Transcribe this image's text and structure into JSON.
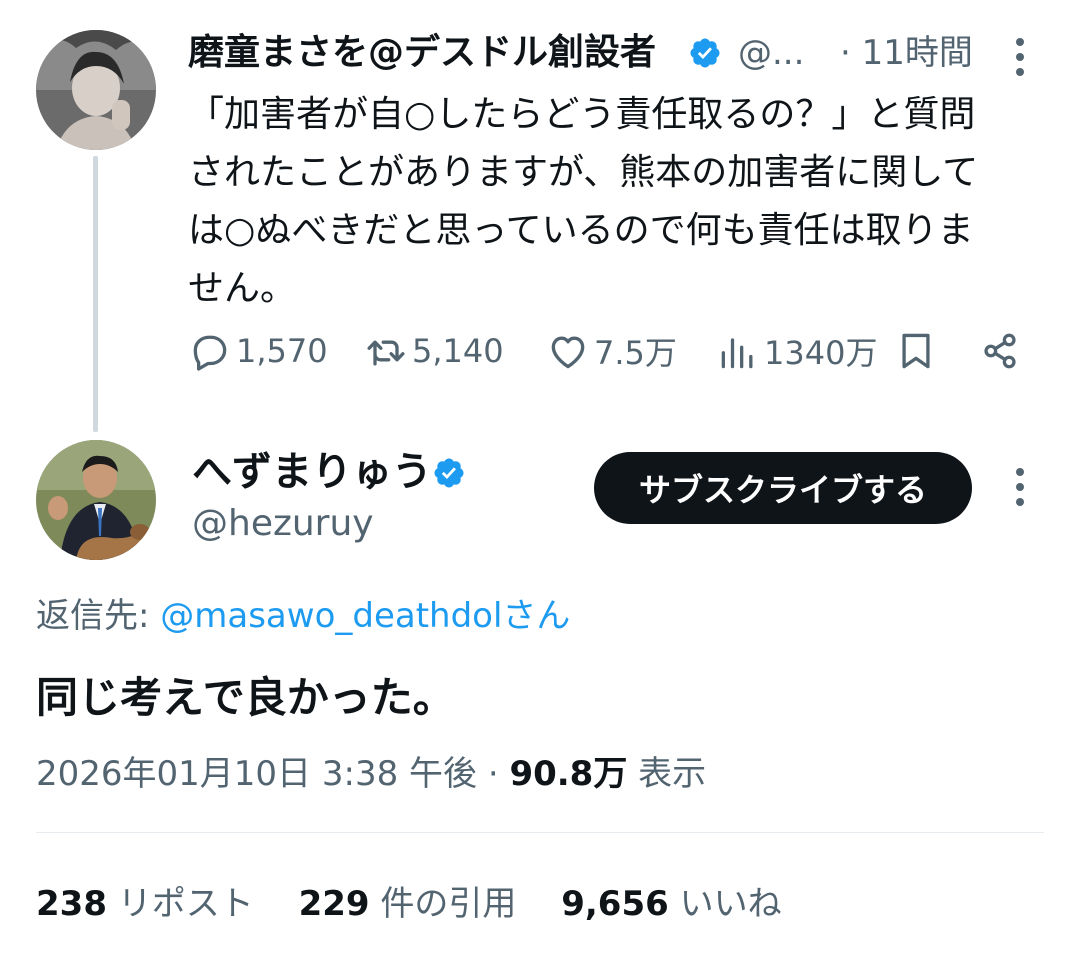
{
  "parent_tweet": {
    "author_name": "磨童まさを@デスドル創設者",
    "author_handle": "@...",
    "time": "· 11時間",
    "lines": [
      "「加害者が自○したらどう責任取るの？」と質問",
      "されたことがありますが、熊本の加害者に関して",
      "は○ぬべきだと思っているので何も責任は取りま",
      "せん。"
    ],
    "replies": "1,570",
    "retweets": "5,140",
    "likes": "7.5万",
    "views": "1340万"
  },
  "reply_tweet": {
    "author_name": "へずまりゅう",
    "author_handle": "@hezuruy",
    "subscribe_label": "サブスクライブする",
    "reply_to_prefix": "返信先: ",
    "reply_to_link": "@masawo_deathdolさん",
    "text": "同じ考えで良かった。",
    "timestamp": "2026年01月10日 3:38 午後 · ",
    "views_count": "90.8万",
    "views_label": " 表示",
    "stats": {
      "reposts_num": "238",
      "reposts_label": " リポスト",
      "quotes_num": "229",
      "quotes_label": " 件の引用",
      "likes_num": "9,656",
      "likes_label": " いいね"
    }
  },
  "colors": {
    "verified_blue": "#1d9bf0",
    "text_primary": "#0f1419",
    "text_secondary": "#536471",
    "link": "#1d9bf0",
    "thread_line": "#cfd9de"
  },
  "icons": [
    "verified-badge-icon",
    "more-options-icon",
    "reply-icon",
    "retweet-icon",
    "like-icon",
    "views-icon",
    "bookmark-icon",
    "share-icon"
  ]
}
